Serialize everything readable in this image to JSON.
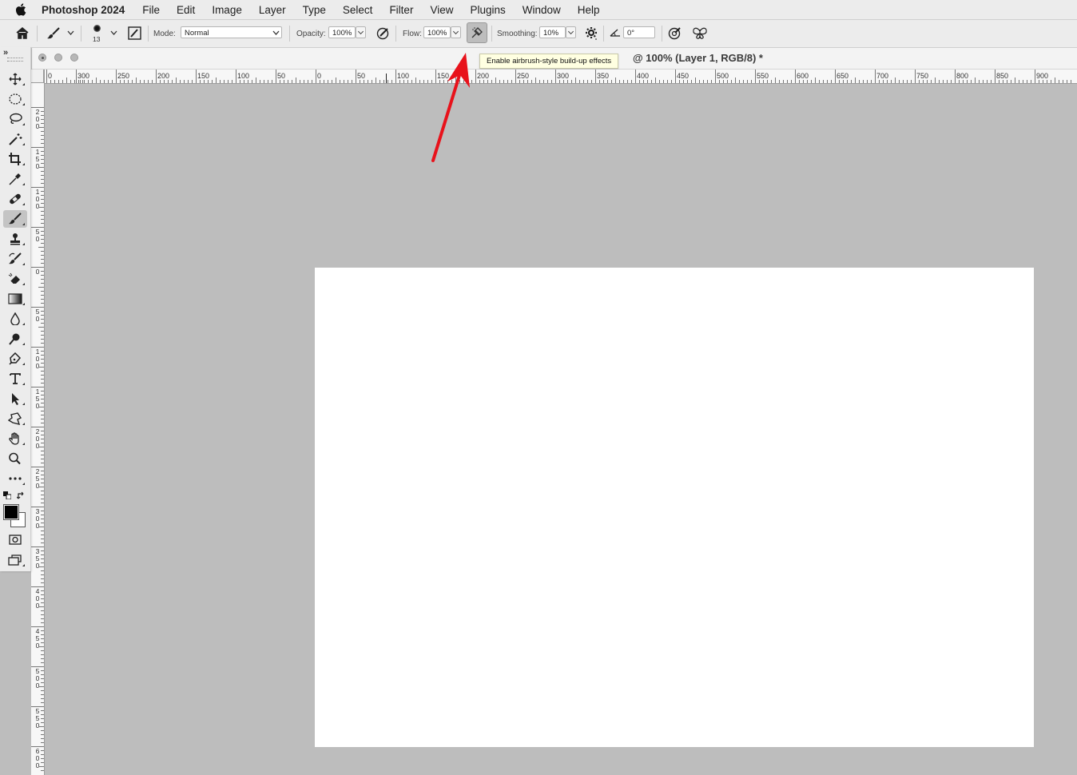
{
  "menubar": {
    "app_name": "Photoshop 2024",
    "items": [
      "File",
      "Edit",
      "Image",
      "Layer",
      "Type",
      "Select",
      "Filter",
      "View",
      "Plugins",
      "Window",
      "Help"
    ]
  },
  "options": {
    "brush_size": "13",
    "mode_label": "Mode:",
    "mode_value": "Normal",
    "opacity_label": "Opacity:",
    "opacity_value": "100%",
    "flow_label": "Flow:",
    "flow_value": "100%",
    "smoothing_label": "Smoothing:",
    "smoothing_value": "10%",
    "angle_value": "0°"
  },
  "tooltip": {
    "text": "Enable airbrush-style build-up effects"
  },
  "document": {
    "title": "@ 100% (Layer 1, RGB/8) *"
  },
  "rulers": {
    "horizontal_labels": [
      "0",
      "300",
      "250",
      "200",
      "150",
      "100",
      "50",
      "0",
      "50",
      "100",
      "150",
      "200",
      "250",
      "300",
      "350",
      "400",
      "450",
      "500",
      "550",
      "600",
      "650",
      "700",
      "750",
      "800",
      "850",
      "900"
    ],
    "vertical_labels": [
      "200",
      "150",
      "100",
      "50",
      "0",
      "50",
      "100",
      "150",
      "200",
      "250",
      "300",
      "350",
      "400",
      "450",
      "500",
      "550",
      "600"
    ]
  },
  "toolbar": {
    "tools": [
      "move",
      "marquee",
      "lasso",
      "magic-wand",
      "crop",
      "eyedropper",
      "healing",
      "brush",
      "stamp",
      "history-brush",
      "eraser",
      "gradient",
      "blur",
      "dodge",
      "pen",
      "type",
      "path-select",
      "shape",
      "hand",
      "zoom",
      "more"
    ]
  },
  "colors": {
    "annotation_arrow": "#e8121b",
    "foreground": "#000000",
    "background": "#ffffff"
  }
}
